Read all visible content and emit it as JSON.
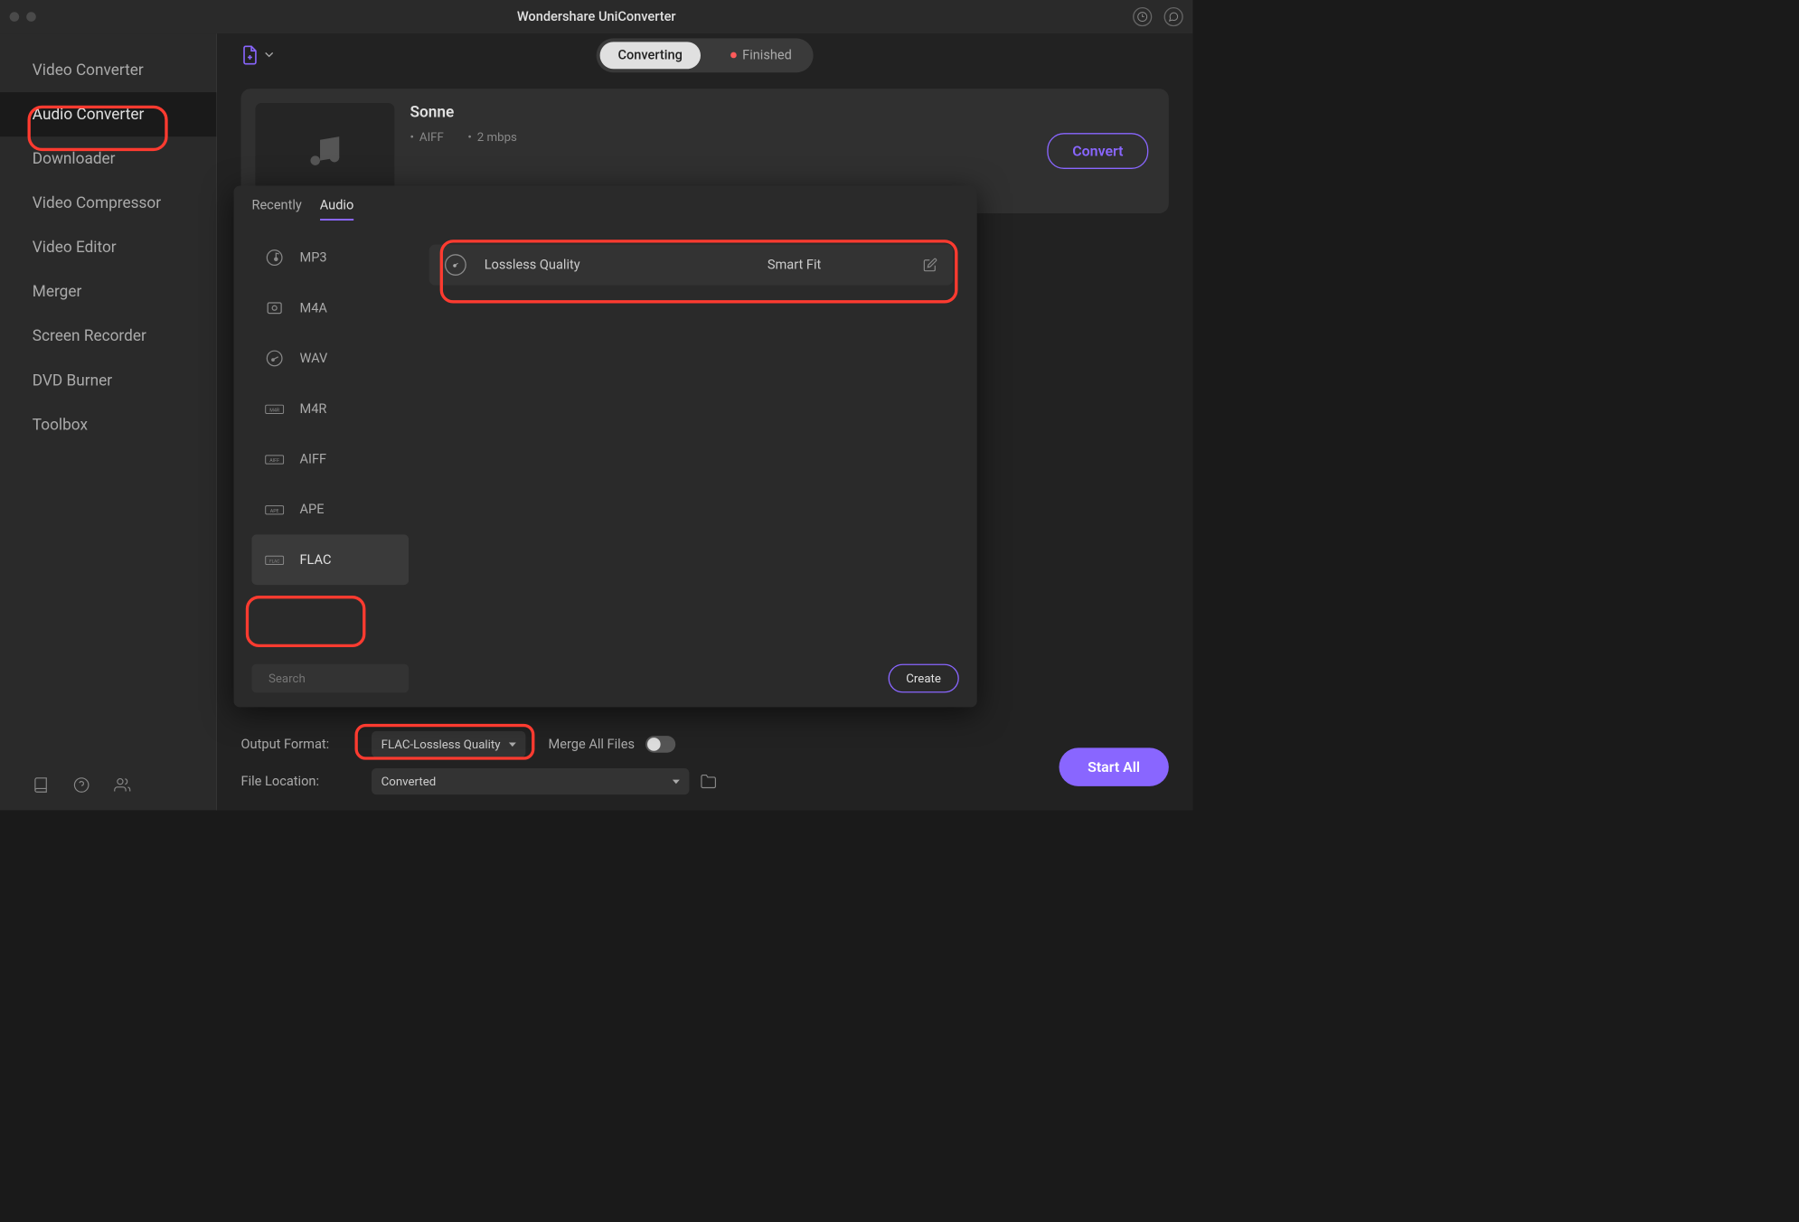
{
  "app_title": "Wondershare UniConverter",
  "sidebar": {
    "items": [
      {
        "label": "Video Converter"
      },
      {
        "label": "Audio Converter"
      },
      {
        "label": "Downloader"
      },
      {
        "label": "Video Compressor"
      },
      {
        "label": "Video Editor"
      },
      {
        "label": "Merger"
      },
      {
        "label": "Screen Recorder"
      },
      {
        "label": "DVD Burner"
      },
      {
        "label": "Toolbox"
      }
    ],
    "active_index": 1
  },
  "main": {
    "tabs": {
      "converting": "Converting",
      "finished": "Finished",
      "active": "converting",
      "finished_indicator": true
    },
    "file": {
      "title": "Sonne",
      "format": "AIFF",
      "bitrate": "2 mbps"
    },
    "convert_button": "Convert"
  },
  "format_popup": {
    "tabs": {
      "recently": "Recently",
      "audio": "Audio",
      "active": "audio"
    },
    "formats": [
      {
        "label": "MP3",
        "icon": "note"
      },
      {
        "label": "M4A",
        "icon": "box"
      },
      {
        "label": "WAV",
        "icon": "wave"
      },
      {
        "label": "M4R",
        "icon": "m4r"
      },
      {
        "label": "AIFF",
        "icon": "aiff"
      },
      {
        "label": "APE",
        "icon": "ape"
      },
      {
        "label": "FLAC",
        "icon": "flac"
      }
    ],
    "selected_format_index": 6,
    "quality": {
      "label": "Lossless Quality",
      "fit": "Smart Fit"
    },
    "search_placeholder": "Search",
    "create_button": "Create"
  },
  "bottom": {
    "output_format_label": "Output Format:",
    "output_format_value": "FLAC-Lossless Quality",
    "merge_label": "Merge All Files",
    "merge_on": false,
    "file_location_label": "File Location:",
    "file_location_value": "Converted",
    "start_all_button": "Start All"
  }
}
